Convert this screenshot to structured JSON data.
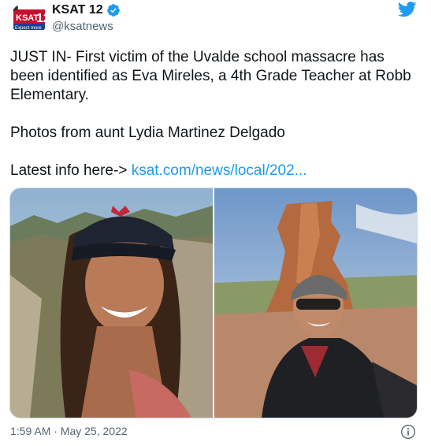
{
  "author": {
    "display_name": "KSAT 12",
    "handle": "@ksatnews",
    "avatar_logo_text": "KSAT 12 Expect more",
    "verified": true
  },
  "tweet": {
    "line1": "JUST IN- First victim of the Uvalde school massacre has been identified as Eva Mireles, a 4th Grade Teacher at Robb Elementary.",
    "line2": "Photos from aunt Lydia Martinez Delgado",
    "line3_prefix": "Latest info here-> ",
    "link_text": "ksat.com/news/local/202..."
  },
  "photos": [
    {
      "icon": "photo-woman-cap-mountains"
    },
    {
      "icon": "photo-woman-beanie-rock-tower"
    }
  ],
  "footer": {
    "timestamp": "1:59 AM · May 25, 2022",
    "info_icon": "info-icon"
  },
  "colors": {
    "accent": "#1d9bf0",
    "text": "#0f1419",
    "muted": "#536471",
    "border": "#cfd9de"
  }
}
